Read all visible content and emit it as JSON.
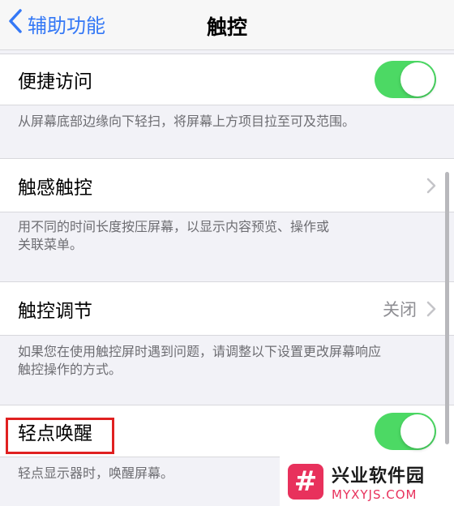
{
  "navbar": {
    "back_label": "辅助功能",
    "title": "触控"
  },
  "sections": [
    {
      "label": "便捷访问",
      "control": "toggle",
      "toggle_on": true,
      "footnote": "从屏幕底部边缘向下轻扫，将屏幕上方项目拉至可及范围。"
    },
    {
      "label": "触感触控",
      "control": "chevron",
      "footnote_lines": [
        "用不同的时间长度按压屏幕，以显示内容预览、操作或",
        "关联菜单。"
      ]
    },
    {
      "label": "触控调节",
      "control": "chevron",
      "detail": "关闭",
      "footnote_lines": [
        "如果您在使用触控屏时遇到问题，请调整以下设置更改屏幕响应",
        "触控操作的方式。"
      ]
    },
    {
      "label": "轻点唤醒",
      "control": "toggle",
      "toggle_on": true,
      "footnote": "轻点显示器时，唤醒屏幕。"
    }
  ],
  "watermark": {
    "logo_glyph": "#",
    "name": "兴业软件园",
    "url": "MYXYJS.COM"
  },
  "colors": {
    "accent": "#3478f6",
    "toggle_on": "#4cd964",
    "highlight": "#e02020",
    "watermark": "#e8315c"
  }
}
